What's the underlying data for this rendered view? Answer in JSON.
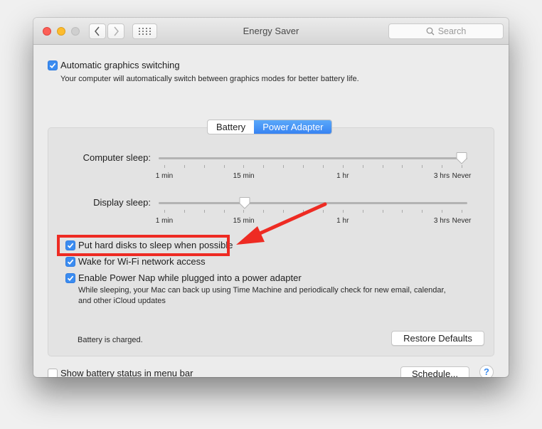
{
  "window": {
    "title": "Energy Saver",
    "search_placeholder": "Search",
    "nav": {
      "back_icon": "chevron-left-icon",
      "forward_icon": "chevron-right-icon",
      "grid_icon": "show-all-grid-icon"
    }
  },
  "graphics_switching": {
    "label": "Automatic graphics switching",
    "checked": true,
    "description": "Your computer will automatically switch between graphics modes for better battery life."
  },
  "tabs": [
    {
      "label": "Battery",
      "active": false
    },
    {
      "label": "Power Adapter",
      "active": true
    }
  ],
  "sliders": {
    "tick_labels": [
      "1 min",
      "15 min",
      "1 hr",
      "3 hrs",
      "Never"
    ],
    "computer_sleep": {
      "label": "Computer sleep:",
      "value": "Never",
      "position_fraction": 1.0
    },
    "display_sleep": {
      "label": "Display sleep:",
      "value": "15 min",
      "position_fraction": 0.27
    }
  },
  "options": [
    {
      "label": "Put hard disks to sleep when possible",
      "checked": true
    },
    {
      "label": "Wake for Wi-Fi network access",
      "checked": true,
      "highlighted": true
    },
    {
      "label": "Enable Power Nap while plugged into a power adapter",
      "checked": true,
      "description": "While sleeping, your Mac can back up using Time Machine and periodically check for new email, calendar, and other iCloud updates"
    }
  ],
  "status_text": "Battery is charged.",
  "restore_defaults_label": "Restore Defaults",
  "show_battery_status": {
    "label": "Show battery status in menu bar",
    "checked": false
  },
  "schedule_label": "Schedule...",
  "help_label": "?",
  "annotation": {
    "color": "#ee2b23",
    "type": "red-box-and-arrow"
  },
  "colors": {
    "accent": "#3b8cf0",
    "annotation": "#ee2b23"
  }
}
